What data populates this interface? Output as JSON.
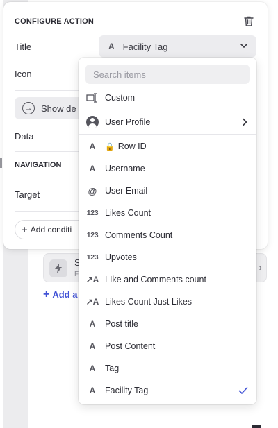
{
  "background": {
    "card_title": "S",
    "card_sub": "F",
    "add_label": "Add a"
  },
  "config": {
    "title": "CONFIGURE ACTION",
    "title_label": "Title",
    "title_value": "Facility Tag",
    "icon_label": "Icon",
    "show_details_label": "Show de",
    "data_label": "Data",
    "navigation_title": "NAVIGATION",
    "target_label": "Target",
    "add_condition_label": "Add conditi"
  },
  "dropdown": {
    "search_placeholder": "Search items",
    "custom_label": "Custom",
    "user_profile_label": "User Profile",
    "items": [
      {
        "icon": "A",
        "label": "Row ID",
        "locked": true,
        "type": "text"
      },
      {
        "icon": "A",
        "label": "Username",
        "type": "text"
      },
      {
        "icon": "@",
        "label": "User Email",
        "type": "email"
      },
      {
        "icon": "123",
        "label": "Likes Count",
        "type": "number"
      },
      {
        "icon": "123",
        "label": "Comments Count",
        "type": "number"
      },
      {
        "icon": "123",
        "label": "Upvotes",
        "type": "number"
      },
      {
        "icon": "↗A",
        "label": "LIke and Comments count",
        "type": "computed"
      },
      {
        "icon": "↗A",
        "label": "Likes Count Just Likes",
        "type": "computed"
      },
      {
        "icon": "A",
        "label": "Post title",
        "type": "text"
      },
      {
        "icon": "A",
        "label": "Post Content",
        "type": "text"
      },
      {
        "icon": "A",
        "label": "Tag",
        "type": "text"
      },
      {
        "icon": "A",
        "label": "Facility Tag",
        "type": "text",
        "selected": true
      }
    ]
  },
  "colors": {
    "accent": "#4253d6",
    "check": "#4253d6"
  }
}
